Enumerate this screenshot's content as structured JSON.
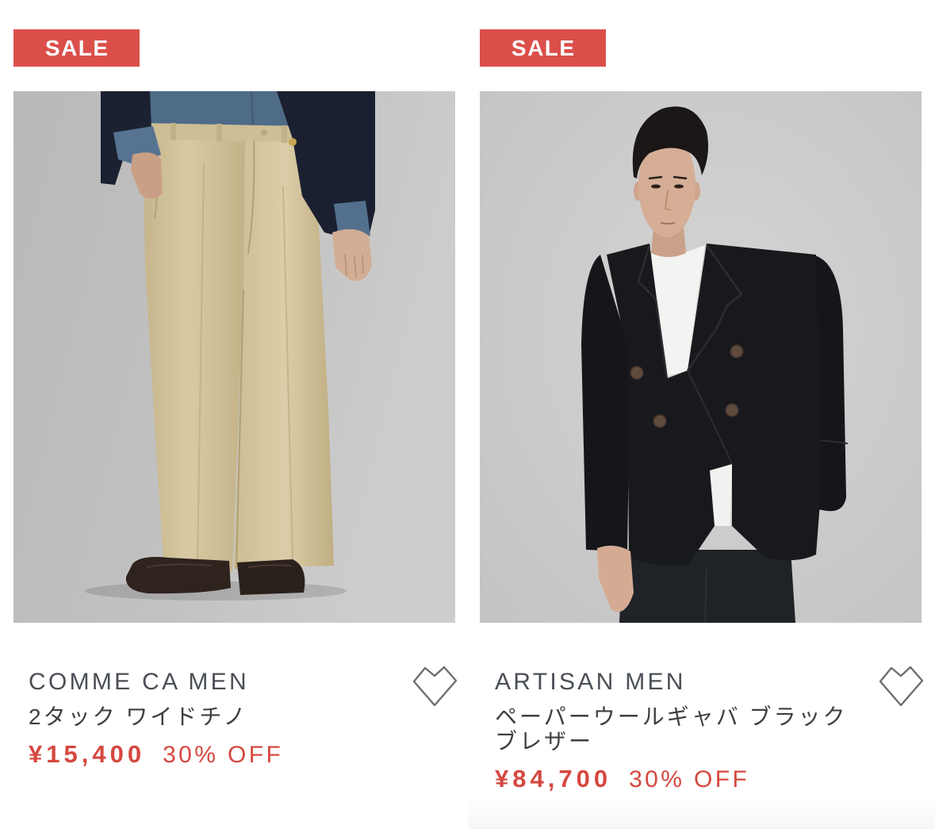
{
  "colors": {
    "sale_badge": "#db4f4a",
    "price": "#d5483f",
    "brand_text": "#4a4f56",
    "name_text": "#3f3f3f",
    "heart_outline": "#6e6e6e",
    "background": "#ffffff"
  },
  "icons": {
    "favorite": "heart-outline-icon"
  },
  "products": [
    {
      "badge": "SALE",
      "brand": "COMME CA MEN",
      "name_lines": [
        "2タック ワイドチノ"
      ],
      "price": "¥15,400",
      "discount": "30% OFF"
    },
    {
      "badge": "SALE",
      "brand": "ARTISAN MEN",
      "name_lines": [
        "ペーパーウールギャバ ブラック",
        "ブレザー"
      ],
      "price": "¥84,700",
      "discount": "30% OFF"
    }
  ]
}
